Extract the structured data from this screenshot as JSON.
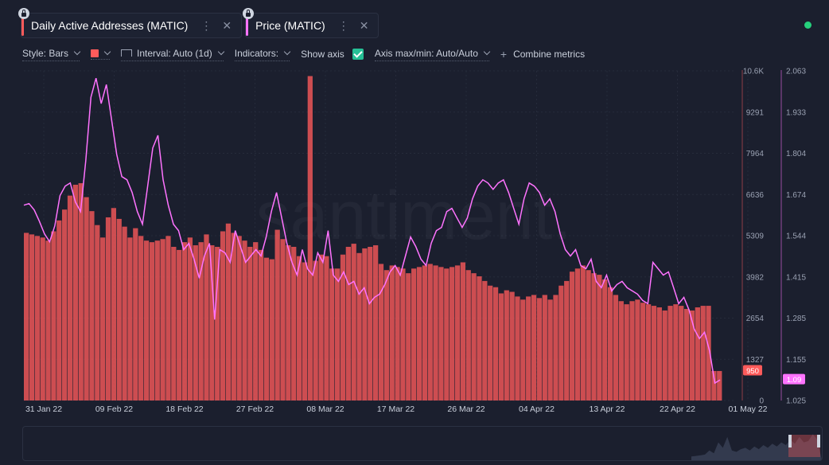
{
  "tabs": [
    {
      "label": "Daily Active Addresses (MATIC)",
      "color": "#ff5b5b",
      "lock_icon": "lock-icon",
      "menu_icon": "more-vertical-icon",
      "close_icon": "close-icon"
    },
    {
      "label": "Price (MATIC)",
      "color": "#ff73ff",
      "lock_icon": "lock-icon",
      "menu_icon": "more-vertical-icon",
      "close_icon": "close-icon"
    }
  ],
  "status": {
    "color": "#26d07c"
  },
  "toolbar": {
    "style_label": "Style: Bars",
    "color_swatch": "#ff5b5b",
    "interval_label": "Interval: Auto (1d)",
    "indicators_label": "Indicators:",
    "show_axis_label": "Show axis",
    "show_axis_checked": true,
    "axis_label": "Axis max/min: Auto/Auto",
    "combine_label": "Combine metrics"
  },
  "watermark": "santiment.",
  "chart_data": {
    "type": "bar",
    "x_tick_labels": [
      "31 Jan 22",
      "09 Feb 22",
      "18 Feb 22",
      "27 Feb 22",
      "08 Mar 22",
      "17 Mar 22",
      "26 Mar 22",
      "04 Apr 22",
      "13 Apr 22",
      "22 Apr 22",
      "01 May 22"
    ],
    "series": [
      {
        "name": "Daily Active Addresses (MATIC)",
        "type": "bar",
        "color": "#ff5b5b",
        "axis": "left",
        "ylim": [
          0,
          10618
        ],
        "ticks": [
          "10.6K",
          "9291",
          "7964",
          "6636",
          "5309",
          "3982",
          "2654",
          "1327",
          "0"
        ],
        "last_value_label": "950",
        "values": [
          5400,
          5350,
          5300,
          5250,
          5150,
          5450,
          5800,
          6150,
          6600,
          6950,
          7000,
          6550,
          6100,
          5650,
          5250,
          5900,
          6200,
          5850,
          5600,
          5250,
          5550,
          5300,
          5150,
          5100,
          5150,
          5200,
          5300,
          4950,
          4850,
          5100,
          5250,
          5000,
          5100,
          5350,
          5000,
          4950,
          5450,
          5700,
          5400,
          5300,
          5150,
          4950,
          5100,
          4850,
          4600,
          4550,
          5500,
          5200,
          5000,
          4950,
          4650,
          4450,
          10450,
          4500,
          4700,
          4650,
          4250,
          4250,
          4700,
          4950,
          5050,
          4750,
          4900,
          4950,
          5000,
          4400,
          4200,
          4350,
          4300,
          4250,
          4100,
          4250,
          4300,
          4350,
          4400,
          4350,
          4300,
          4250,
          4300,
          4350,
          4450,
          4200,
          4100,
          4000,
          3850,
          3700,
          3650,
          3450,
          3550,
          3500,
          3350,
          3250,
          3350,
          3400,
          3300,
          3400,
          3250,
          3400,
          3700,
          3850,
          4150,
          4250,
          4350,
          4200,
          4100,
          4050,
          3900,
          3650,
          3400,
          3200,
          3100,
          3200,
          3250,
          3150,
          3100,
          3050,
          3000,
          2900,
          3050,
          3100,
          3050,
          2950,
          2900,
          3000,
          3050,
          3050,
          950,
          950
        ]
      },
      {
        "name": "Price (MATIC)",
        "type": "line",
        "color": "#ff73ff",
        "axis": "right",
        "ylim": [
          1.025,
          2.063
        ],
        "ticks": [
          "2.063",
          "1.933",
          "1.804",
          "1.674",
          "1.544",
          "1.415",
          "1.285",
          "1.155",
          "1.025"
        ],
        "last_value_label": "1.09",
        "values": [
          1.64,
          1.645,
          1.625,
          1.59,
          1.55,
          1.525,
          1.575,
          1.67,
          1.7,
          1.71,
          1.65,
          1.62,
          1.78,
          1.98,
          2.04,
          1.96,
          2.02,
          1.91,
          1.8,
          1.73,
          1.72,
          1.68,
          1.62,
          1.58,
          1.7,
          1.82,
          1.86,
          1.72,
          1.64,
          1.58,
          1.56,
          1.5,
          1.52,
          1.47,
          1.41,
          1.48,
          1.52,
          1.28,
          1.5,
          1.49,
          1.46,
          1.56,
          1.51,
          1.46,
          1.48,
          1.5,
          1.48,
          1.54,
          1.62,
          1.68,
          1.6,
          1.52,
          1.46,
          1.42,
          1.5,
          1.44,
          1.42,
          1.49,
          1.46,
          1.56,
          1.42,
          1.4,
          1.43,
          1.39,
          1.4,
          1.36,
          1.38,
          1.33,
          1.35,
          1.36,
          1.39,
          1.43,
          1.45,
          1.42,
          1.48,
          1.54,
          1.51,
          1.47,
          1.45,
          1.52,
          1.56,
          1.57,
          1.62,
          1.63,
          1.6,
          1.57,
          1.6,
          1.66,
          1.7,
          1.72,
          1.71,
          1.69,
          1.71,
          1.72,
          1.68,
          1.63,
          1.58,
          1.66,
          1.71,
          1.7,
          1.68,
          1.64,
          1.66,
          1.62,
          1.55,
          1.5,
          1.48,
          1.5,
          1.45,
          1.44,
          1.47,
          1.4,
          1.38,
          1.42,
          1.37,
          1.39,
          1.4,
          1.38,
          1.37,
          1.36,
          1.34,
          1.33,
          1.46,
          1.44,
          1.42,
          1.43,
          1.38,
          1.33,
          1.35,
          1.31,
          1.25,
          1.22,
          1.24,
          1.18,
          1.08,
          1.09
        ]
      }
    ]
  }
}
